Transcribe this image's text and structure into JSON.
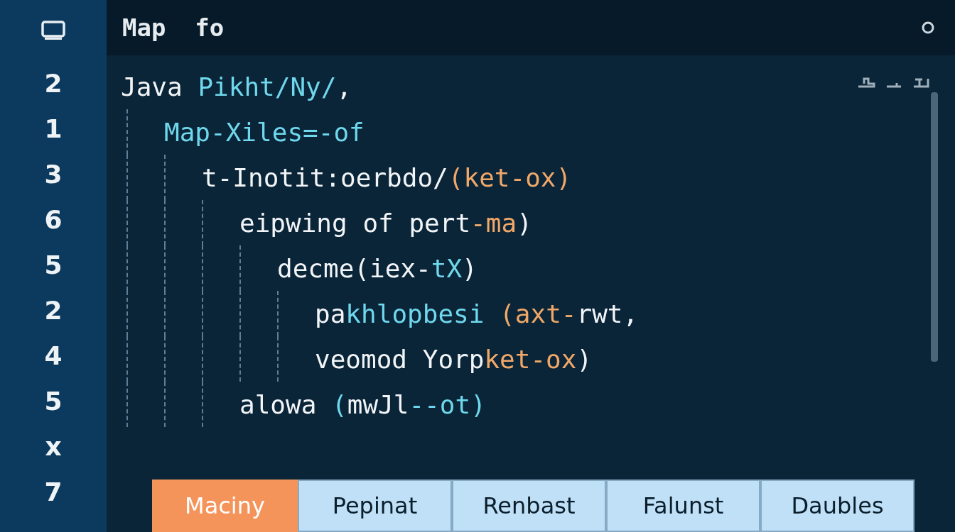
{
  "editor": {
    "title": "Map  fo"
  },
  "line_numbers": [
    "2",
    "1",
    "3",
    "6",
    "5",
    "2",
    "4",
    "5",
    "x",
    "7"
  ],
  "code": [
    {
      "segments": [
        {
          "text": "Java ",
          "kind": "plain"
        },
        {
          "text": "Pikht/Ny/",
          "kind": "accent"
        },
        {
          "text": ",",
          "kind": "plain"
        }
      ],
      "children": [
        {
          "segments": [
            {
              "text": "Map-Xiles=-of",
              "kind": "accent"
            }
          ],
          "children": [
            {
              "segments": [
                {
                  "text": "t-Inotit:oerbdo/",
                  "kind": "plain"
                },
                {
                  "text": "(ket-ox)",
                  "kind": "string"
                }
              ],
              "children": [
                {
                  "segments": [
                    {
                      "text": "eipwing of pert",
                      "kind": "plain"
                    },
                    {
                      "text": "-ma",
                      "kind": "string"
                    },
                    {
                      "text": ")",
                      "kind": "plain"
                    }
                  ],
                  "children": [
                    {
                      "segments": [
                        {
                          "text": "decme(iex-",
                          "kind": "plain"
                        },
                        {
                          "text": "tX",
                          "kind": "accent"
                        },
                        {
                          "text": ")",
                          "kind": "plain"
                        }
                      ],
                      "children": [
                        {
                          "segments": [
                            {
                              "text": "pa",
                              "kind": "plain"
                            },
                            {
                              "text": "khlopbesi ",
                              "kind": "accent"
                            },
                            {
                              "text": "(axt-",
                              "kind": "string"
                            },
                            {
                              "text": "rwt,",
                              "kind": "plain"
                            }
                          ]
                        },
                        {
                          "segments": [
                            {
                              "text": "veomod Yorp",
                              "kind": "plain"
                            },
                            {
                              "text": "ket-ox",
                              "kind": "string"
                            },
                            {
                              "text": ")",
                              "kind": "plain"
                            }
                          ]
                        }
                      ]
                    }
                  ]
                },
                {
                  "segments": [
                    {
                      "text": "alowa ",
                      "kind": "plain"
                    },
                    {
                      "text": "(",
                      "kind": "accent"
                    },
                    {
                      "text": "mwJl",
                      "kind": "plain"
                    },
                    {
                      "text": "--ot)",
                      "kind": "accent"
                    }
                  ]
                }
              ]
            }
          ]
        }
      ]
    }
  ],
  "tabs": [
    {
      "label": "Maciny",
      "selected": true
    },
    {
      "label": "Pepinat",
      "selected": false
    },
    {
      "label": "Renbast",
      "selected": false
    },
    {
      "label": "Falunst",
      "selected": false
    },
    {
      "label": "Daubles",
      "selected": false
    }
  ]
}
